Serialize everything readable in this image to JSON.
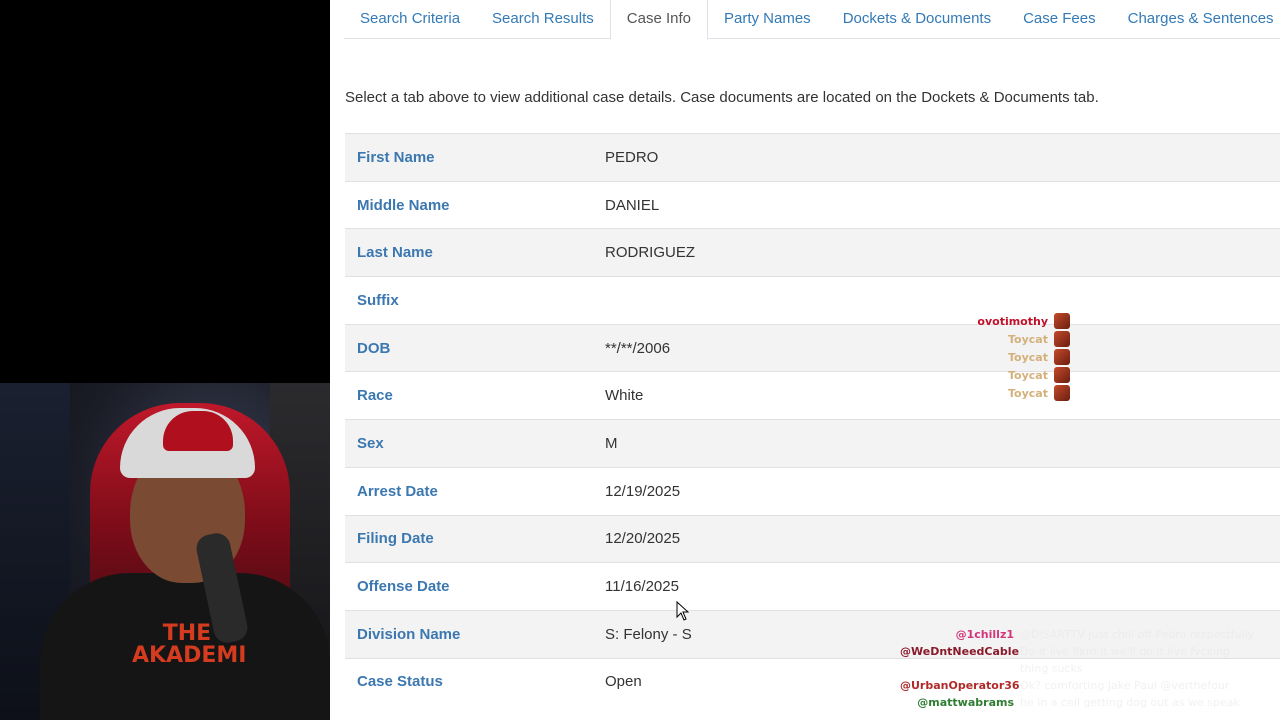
{
  "tabs": [
    {
      "label": "Search Criteria"
    },
    {
      "label": "Search Results"
    },
    {
      "label": "Case Info"
    },
    {
      "label": "Party Names"
    },
    {
      "label": "Dockets & Documents"
    },
    {
      "label": "Case Fees"
    },
    {
      "label": "Charges & Sentences"
    }
  ],
  "active_tab": "Case Info",
  "intro_text": "Select a tab above to view additional case details. Case documents are located on the Dockets & Documents tab.",
  "fields": [
    {
      "label": "First Name",
      "value": "PEDRO"
    },
    {
      "label": "Middle Name",
      "value": "DANIEL"
    },
    {
      "label": "Last Name",
      "value": "RODRIGUEZ"
    },
    {
      "label": "Suffix",
      "value": ""
    },
    {
      "label": "DOB",
      "value": "**/**/2006"
    },
    {
      "label": "Race",
      "value": "White"
    },
    {
      "label": "Sex",
      "value": "M"
    },
    {
      "label": "Arrest Date",
      "value": "12/19/2025"
    },
    {
      "label": "Filing Date",
      "value": "12/20/2025"
    },
    {
      "label": "Offense Date",
      "value": "11/16/2025"
    },
    {
      "label": "Division Name",
      "value": "S: Felony - S"
    },
    {
      "label": "Case Status",
      "value": "Open"
    }
  ],
  "webcam": {
    "hoodie_text": "THE AKADEMI"
  },
  "chat_top": [
    {
      "user": "ovotimothy",
      "color": "#c0102a"
    },
    {
      "user": "Toycat",
      "color": "#d4b07a"
    },
    {
      "user": "Toycat",
      "color": "#d4b07a"
    },
    {
      "user": "Toycat",
      "color": "#d4b07a"
    },
    {
      "user": "Toycat",
      "color": "#d4b07a"
    }
  ],
  "chat_bottom": [
    {
      "user": "@1chillz1",
      "color": "#d2367a",
      "text": "@DjSARTTV just chill off Pedro respectfully"
    },
    {
      "user": "@WeDntNeedCable",
      "color": "#8a1a2a",
      "text": "Do it live lfkm it we'll do it live fvcking thing sucks"
    },
    {
      "user": "@UrbanOperator36",
      "color": "#b02a2a",
      "text": "Ok? comforting Jake Paul @verthefour"
    },
    {
      "user": "@mattwabrams",
      "color": "#2e7d32",
      "text": "he in a cell getting dog out as we speak"
    }
  ]
}
